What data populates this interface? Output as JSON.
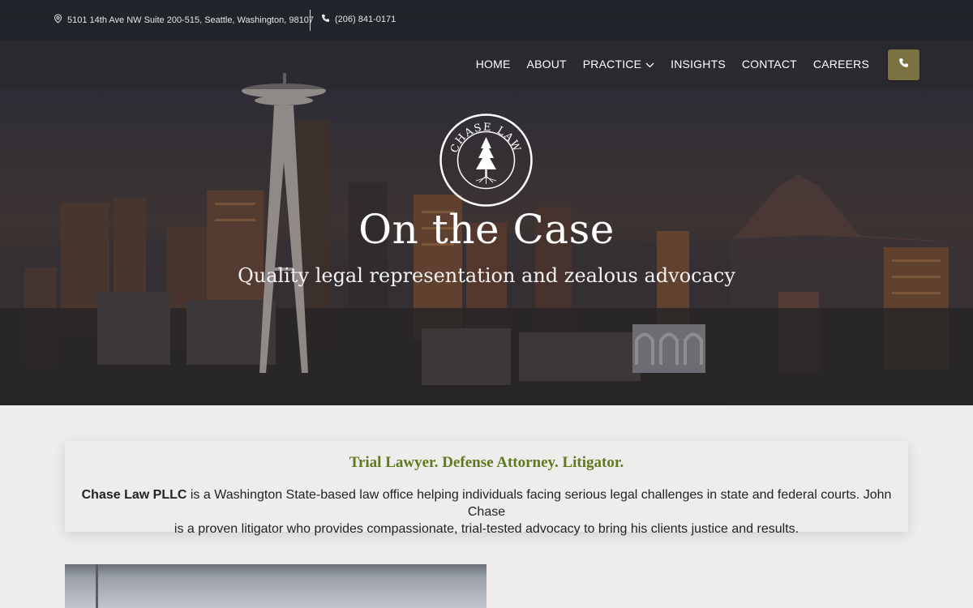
{
  "topbar": {
    "address": "5101 14th Ave NW Suite 200-515, Seattle, Washington, 98107",
    "phone": "(206) 841-0171"
  },
  "nav": {
    "items": [
      {
        "label": "HOME"
      },
      {
        "label": "ABOUT"
      },
      {
        "label": "PRACTICE",
        "has_dropdown": true
      },
      {
        "label": "INSIGHTS"
      },
      {
        "label": "CONTACT"
      },
      {
        "label": "CAREERS"
      }
    ],
    "call_button_icon": "phone-icon",
    "accent": "#7a7240"
  },
  "hero": {
    "logo_text": "CHASE LAW",
    "title": "On the Case",
    "subtitle": "Quality legal representation and zealous advocacy"
  },
  "intro": {
    "tagline": "Trial Lawyer. Defense Attorney. Litigator.",
    "firm_name": "Chase Law PLLC",
    "description_line1": " is a Washington State-based law office helping individuals facing serious legal challenges in state and federal courts. John Chase",
    "description_line2": "is a proven litigator who provides compassionate, trial-tested advocacy to bring his clients justice and results.",
    "tagline_color": "#5e7a1e"
  }
}
